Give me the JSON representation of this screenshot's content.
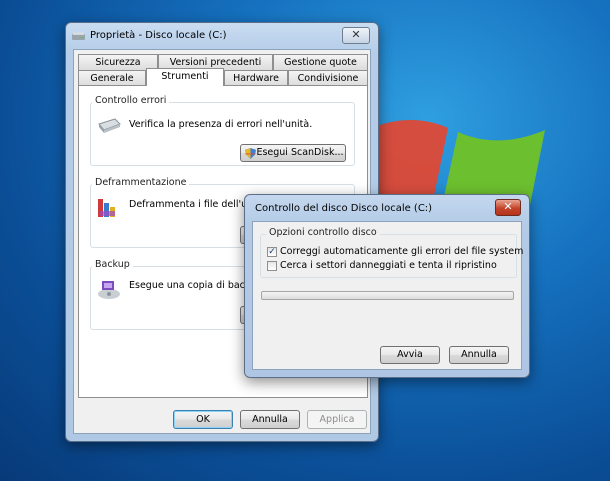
{
  "properties_window": {
    "title": "Proprietà - Disco locale (C:)",
    "close_glyph": "✕",
    "tabs_row1": [
      "Sicurezza",
      "Versioni precedenti",
      "Gestione quote"
    ],
    "tabs_row2": [
      "Generale",
      "Strumenti",
      "Hardware",
      "Condivisione"
    ],
    "active_tab": "Strumenti",
    "error_check": {
      "title": "Controllo errori",
      "description": "Verifica la presenza di errori nell'unità.",
      "button": "Esegui ScanDisk..."
    },
    "defrag": {
      "title": "Deframmentazione",
      "description": "Deframmenta i file dell'unità."
    },
    "backup": {
      "title": "Backup",
      "description": "Esegue una copia di backup"
    },
    "buttons": {
      "ok": "OK",
      "cancel": "Annulla",
      "apply": "Applica"
    }
  },
  "check_dialog": {
    "title": "Controllo del disco Disco locale (C:)",
    "close_glyph": "✕",
    "group_title": "Opzioni controllo disco",
    "option1": {
      "label": "Correggi automaticamente gli errori del file system",
      "checked": true
    },
    "option2": {
      "label": "Cerca i settori danneggiati e tenta il ripristino",
      "checked": false
    },
    "progress": 0,
    "buttons": {
      "start": "Avvia",
      "cancel": "Annulla"
    }
  },
  "icons": [
    "drive-icon",
    "defrag-icon",
    "backup-icon",
    "shield-icon",
    "windows-logo-icon"
  ]
}
